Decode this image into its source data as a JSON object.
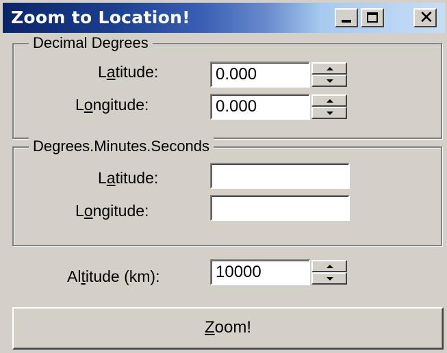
{
  "window": {
    "title": "Zoom to Location!",
    "minimize_glyph": "_",
    "close_glyph": "✕"
  },
  "decimal_degrees": {
    "legend": "Decimal Degrees",
    "latitude_label_pre": "L",
    "latitude_label_accel": "a",
    "latitude_label_post": "titude:",
    "latitude_value": "0.000",
    "longitude_label_pre": "L",
    "longitude_label_accel": "o",
    "longitude_label_post": "ngitude:",
    "longitude_value": "0.000"
  },
  "dms": {
    "legend": "Degrees.Minutes.Seconds",
    "latitude_label_pre": "L",
    "latitude_label_accel": "a",
    "latitude_label_post": "titude:",
    "latitude_value": "",
    "longitude_label_pre": "L",
    "longitude_label_accel": "o",
    "longitude_label_post": "ngitude:",
    "longitude_value": ""
  },
  "altitude": {
    "label_pre": "Al",
    "label_accel": "t",
    "label_post": "itude (km):",
    "value": "10000"
  },
  "zoom_button": {
    "accel": "Z",
    "label_post": "oom!"
  }
}
